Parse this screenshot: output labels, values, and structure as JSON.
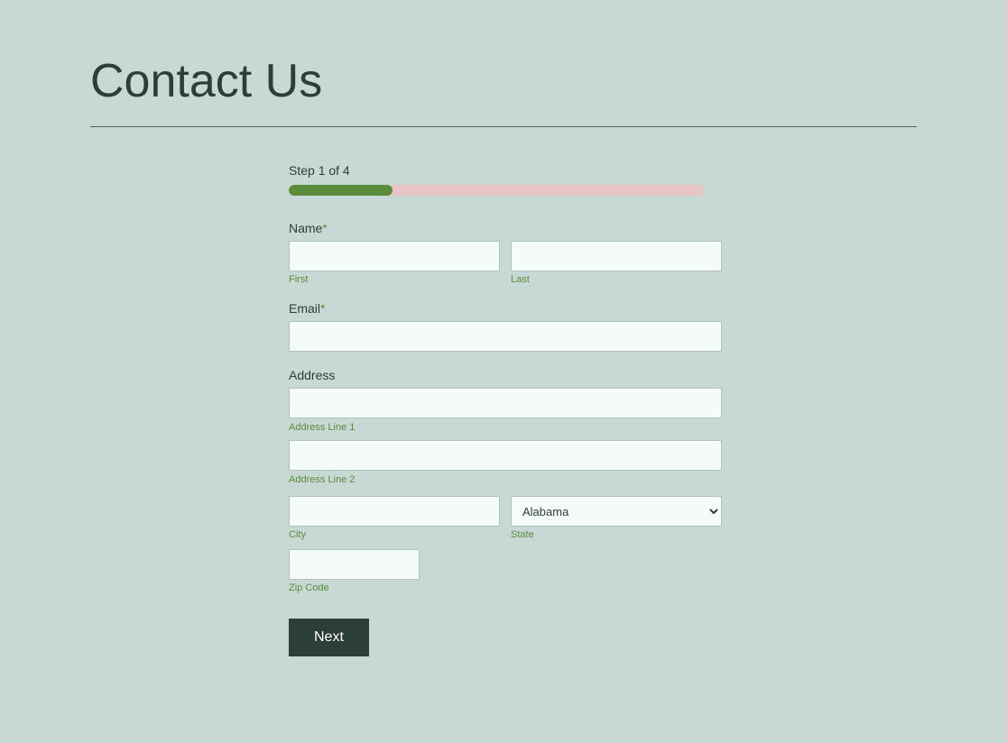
{
  "page": {
    "title": "Contact Us",
    "divider": true
  },
  "step": {
    "label": "Step 1 of 4",
    "current": 1,
    "total": 4,
    "progress_percent": 25
  },
  "form": {
    "name_label": "Name",
    "name_required": "*",
    "first_label": "First",
    "last_label": "Last",
    "email_label": "Email",
    "email_required": "*",
    "address_label": "Address",
    "address_line1_label": "Address Line 1",
    "address_line2_label": "Address Line 2",
    "city_label": "City",
    "state_label": "State",
    "zip_label": "Zip Code",
    "state_default": "Alabama",
    "next_button": "Next"
  }
}
